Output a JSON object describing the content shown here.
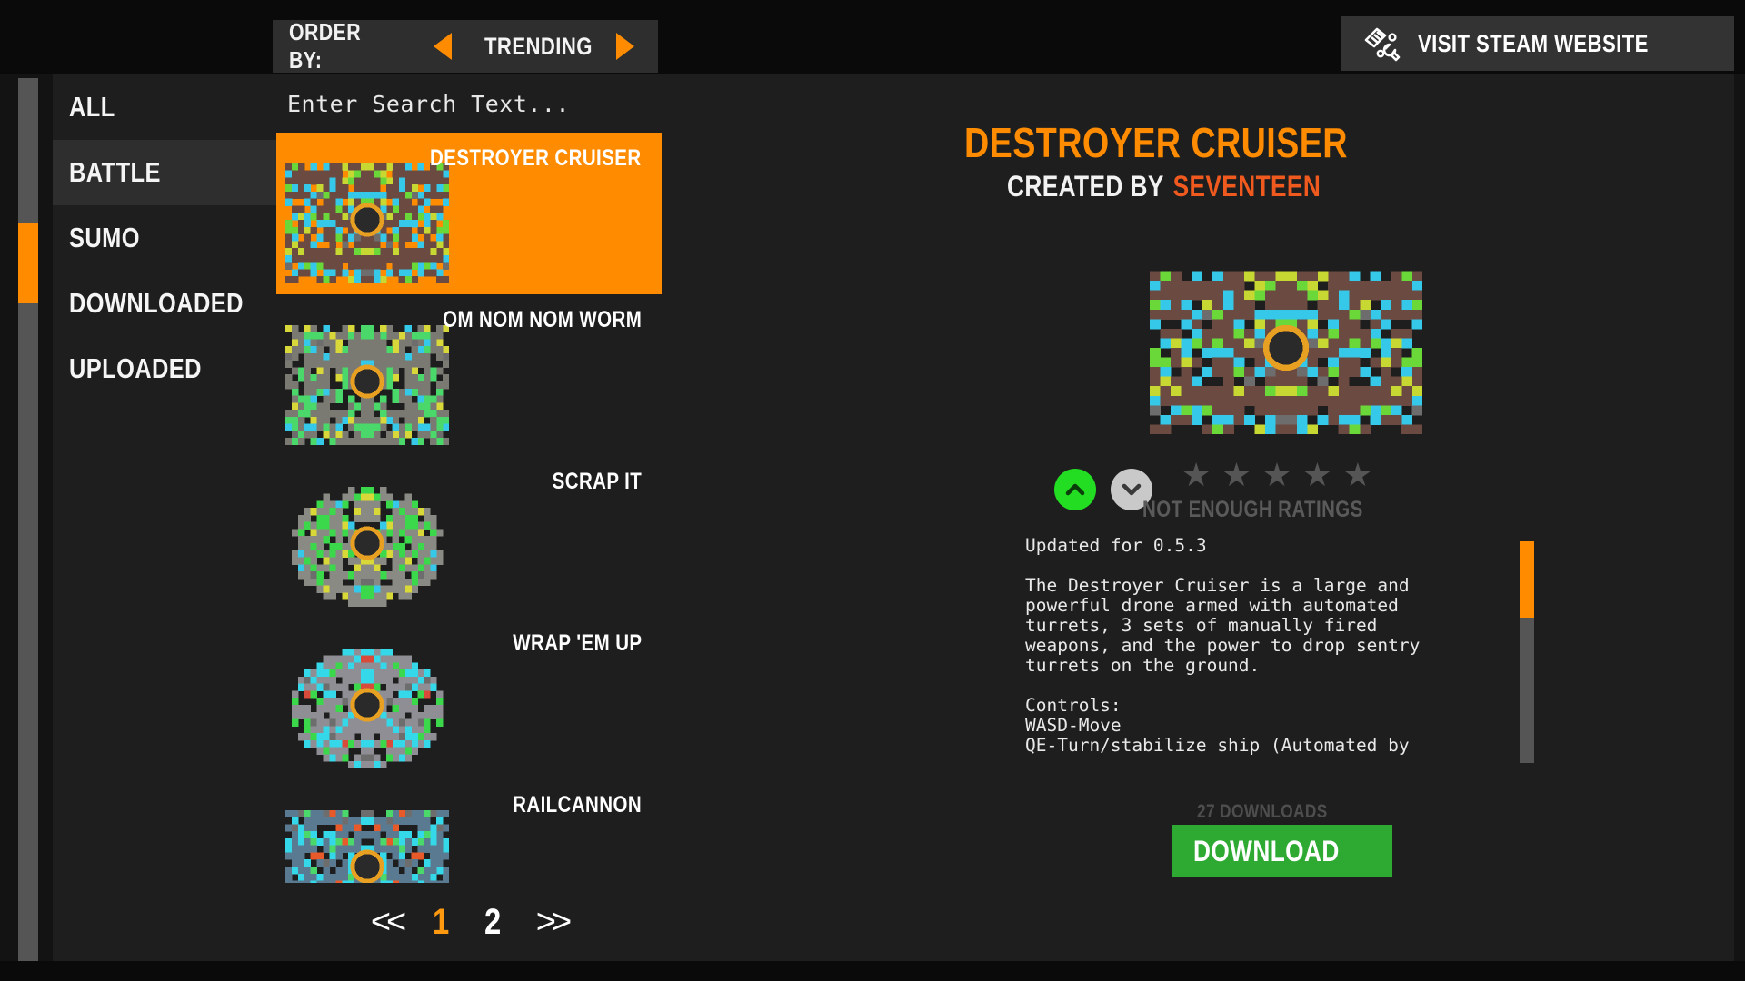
{
  "topbar": {
    "order_by_label": "ORDER BY:",
    "order_by_value": "TRENDING",
    "prev_icon": "triangle-left-icon",
    "next_icon": "triangle-right-icon",
    "steam_button_label": "VISIT STEAM WEBSITE",
    "steam_icon": "tools-wrench-icon"
  },
  "sidebar": {
    "items": [
      {
        "label": "ALL",
        "active": false
      },
      {
        "label": "BATTLE",
        "active": true
      },
      {
        "label": "SUMO",
        "active": false
      },
      {
        "label": "DOWNLOADED",
        "active": false
      },
      {
        "label": "UPLOADED",
        "active": false
      }
    ]
  },
  "search": {
    "placeholder": "Enter Search Text...",
    "value": ""
  },
  "list": {
    "items": [
      {
        "name": "DESTROYER CRUISER",
        "selected": true
      },
      {
        "name": "OM NOM NOM WORM",
        "selected": false
      },
      {
        "name": "SCRAP IT",
        "selected": false
      },
      {
        "name": "WRAP 'EM UP",
        "selected": false
      },
      {
        "name": "RAILCANNON",
        "selected": false
      }
    ]
  },
  "pagination": {
    "first_label": "<<",
    "last_label": ">>",
    "pages": [
      "1",
      "2"
    ],
    "current_page": "1"
  },
  "detail": {
    "title": "DESTROYER CRUISER",
    "created_by_label": "CREATED BY",
    "author": "SEVENTEEN",
    "upvote_icon": "chevron-up-icon",
    "downvote_icon": "chevron-down-icon",
    "star_count": 5,
    "rating_text": "NOT ENOUGH RATINGS",
    "description": "Updated for 0.5.3\n\nThe Destroyer Cruiser is a large and\npowerful drone armed with automated\nturrets, 3 sets of manually fired\nweapons, and the power to drop sentry\nturrets on the ground.\n\nControls:\nWASD-Move\nQE-Turn/stabilize ship (Automated by",
    "downloads_text": "27 DOWNLOADS",
    "download_button_label": "DOWNLOAD"
  },
  "colors": {
    "accent_orange": "#ff8c00",
    "author_orange": "#f05a1e",
    "download_green": "#2eaa33",
    "upvote_green": "#22dd22",
    "panel_bg": "#1e1e1e",
    "bar_bg": "#2e2e2e",
    "page_bg": "#0a0a0a"
  }
}
